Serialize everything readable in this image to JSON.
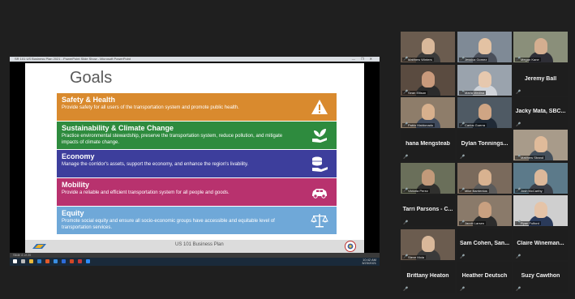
{
  "share": {
    "window_title": "SR 101 US Business Plan 2021 - PowerPoint Slide Show - Microsoft PowerPoint",
    "window_controls": "— ❐ ✕",
    "status_text": "Slide 4 of 20",
    "clock_time": "10:42 AM",
    "clock_date": "3/23/2021"
  },
  "slide": {
    "title": "Goals",
    "footer_text": "US 101 Business Plan",
    "goals": [
      {
        "title": "Safety & Health",
        "desc": "Provide safety for all users of the transportation system and promote public health.",
        "color": "#d98a2e",
        "icon": "warning-icon"
      },
      {
        "title": "Sustainability & Climate Change",
        "desc": "Practice environmental stewardship, preserve the transportation system, reduce pollution, and mitigate impacts of climate change.",
        "color": "#2e8b3e",
        "icon": "plant-hand-icon"
      },
      {
        "title": "Economy",
        "desc": "Manage the corridor's assets, support the economy, and enhance the region's livability.",
        "color": "#3d3e9c",
        "icon": "coins-hand-icon"
      },
      {
        "title": "Mobility",
        "desc": "Provide a reliable and efficient transportation system for all people and goods.",
        "color": "#b8326e",
        "icon": "car-icon"
      },
      {
        "title": "Equity",
        "desc": "Promote social equity and ensure all socio-economic groups have accessible and equitable level of transportation services.",
        "color": "#6fa8d8",
        "icon": "scales-icon"
      }
    ]
  },
  "participants": [
    {
      "name": "Matthew Winters",
      "type": "video"
    },
    {
      "name": "Jessica Gomez",
      "type": "video"
    },
    {
      "name": "Megan Kane",
      "type": "video"
    },
    {
      "name": "Sean Ellison",
      "type": "video"
    },
    {
      "name": "Maria Medina",
      "type": "video"
    },
    {
      "name": "Jeremy Ball",
      "type": "text"
    },
    {
      "name": "Pablo Maldonado",
      "type": "video"
    },
    {
      "name": "Carlos Guerra",
      "type": "video"
    },
    {
      "name": "Jacky Mata, SBC...",
      "type": "text"
    },
    {
      "name": "hana Mengsteab",
      "type": "text"
    },
    {
      "name": "Dylan Tonnings...",
      "type": "text"
    },
    {
      "name": "Matthew Strand",
      "type": "video"
    },
    {
      "name": "Victoria Perez",
      "type": "video"
    },
    {
      "name": "Mike Barrientos",
      "type": "video"
    },
    {
      "name": "Josh McCarthy",
      "type": "video"
    },
    {
      "name": "Tarri Parsons - C...",
      "type": "text"
    },
    {
      "name": "Jacob Larsen",
      "type": "video"
    },
    {
      "name": "Ryan Fulford",
      "type": "video"
    },
    {
      "name": "Steve Mola",
      "type": "video"
    },
    {
      "name": "Sam Cohen, San...",
      "type": "text"
    },
    {
      "name": "Claire Wineman...",
      "type": "text"
    },
    {
      "name": "Brittany Heaton",
      "type": "text"
    },
    {
      "name": "Heather Deutsch",
      "type": "text"
    },
    {
      "name": "Suzy Cawthon",
      "type": "text"
    }
  ]
}
